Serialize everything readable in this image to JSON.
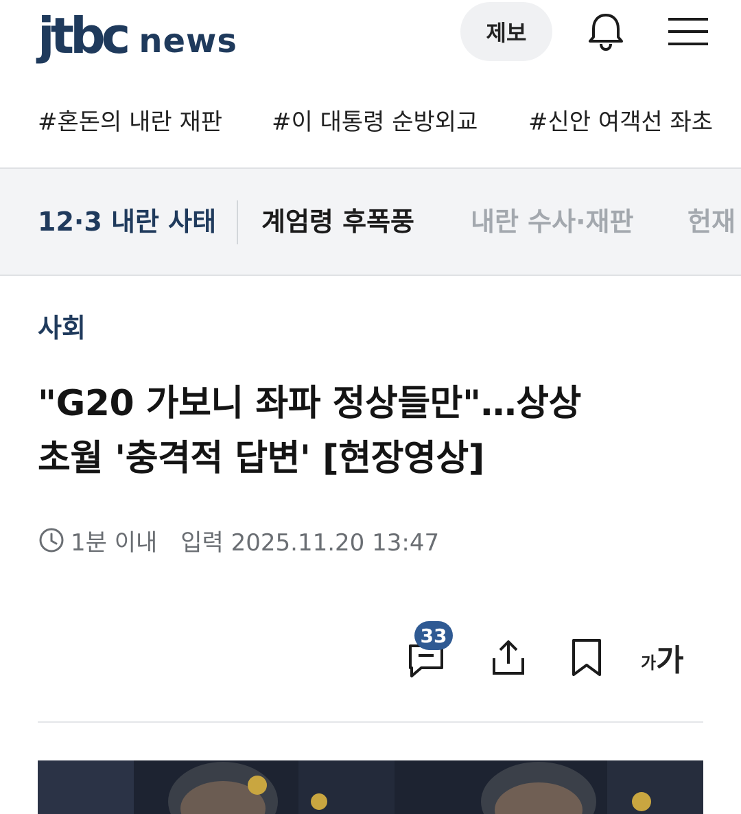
{
  "header": {
    "logo_jtbc": "jtbc",
    "logo_news": "news",
    "tip_button": "제보",
    "icons": {
      "notifications": "bell-icon",
      "menu": "hamburger-menu-icon"
    },
    "brand_color": "#1f3a5c"
  },
  "hashtags": [
    "#혼돈의 내란 재판",
    "#이 대통령 순방외교",
    "#신안 여객선 좌초"
  ],
  "topic_bar": {
    "label": "12·3 내란 사태",
    "tabs": [
      "계엄령 후폭풍",
      "내란 수사·재판",
      "헌재"
    ],
    "active_tab": "계엄령 후폭풍"
  },
  "article": {
    "section": "사회",
    "headline_line1": "\"G20 가보니 좌파 정상들만\"…상상",
    "headline_line2": "초월 '충격적 답변' [현장영상]",
    "read_time": "1분 이내",
    "published": "입력 2025.11.20 13:47"
  },
  "actions": {
    "comment_count": "33",
    "font_small": "가",
    "font_large": "가",
    "icons": {
      "comment": "comment-icon",
      "share": "share-icon",
      "bookmark": "bookmark-icon",
      "font_size": "font-size-icon"
    },
    "badge_color": "#2f5a93"
  }
}
